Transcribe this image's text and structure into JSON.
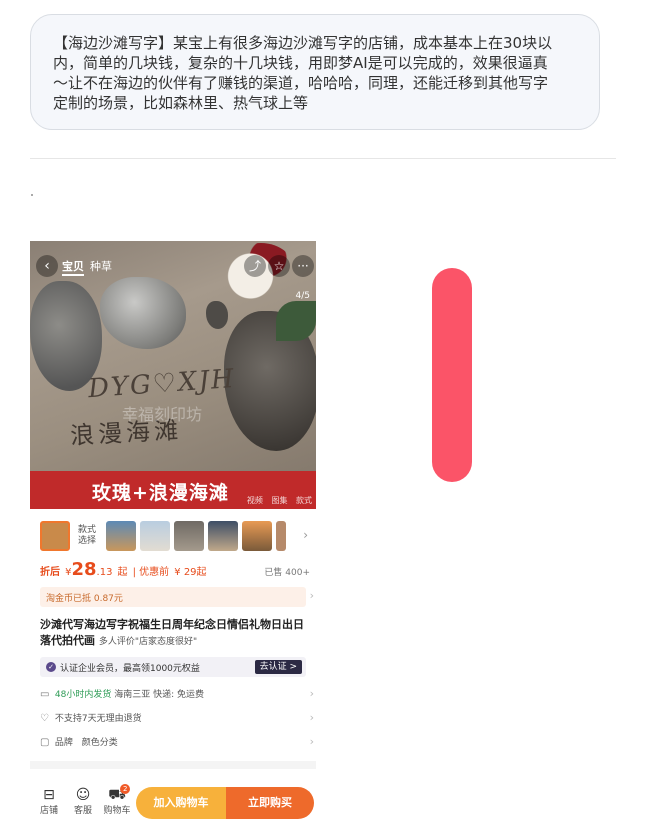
{
  "post": {
    "lines": [
      "【海边沙滩写字】某宝上有很多海边沙滩写字的店铺，成本基本上在30块以",
      "内，简单的几块钱，复杂的十几块钱，用即梦AI是可以完成的，效果很逼真",
      "～让不在海边的伙伴有了赚钱的渠道，哈哈哈，同理，还能迁移到其他写字",
      "定制的场景，比如森林里、热气球上等"
    ]
  },
  "product": {
    "topbar": {
      "tab1": "宝贝",
      "tab2": "种草",
      "counter": "4/5"
    },
    "hero": {
      "sand_text": "DYG♡XJH",
      "sand_text2": "浪漫海滩",
      "watermark": "幸福刻印坊"
    },
    "banner": {
      "text": "玫瑰+浪漫海滩",
      "tabs": [
        "视频",
        "图集",
        "款式"
      ]
    },
    "style_label_1": "款式",
    "style_label_2": "选择",
    "price": {
      "label": "折后",
      "currency": "¥",
      "main": "28",
      "decimal": ".13",
      "suffix": "起",
      "before_label": "| 优惠前",
      "before_value": "¥ 29起",
      "sold": "已售 400+"
    },
    "coin": "淘金币已抵 0.87元",
    "title": "沙滩代写海边写字祝福生日周年纪念日情侣礼物日出日落代拍代画",
    "review": "多人评价\"店家态度很好\"",
    "cert": {
      "text": "认证企业会员，最高领1000元权益",
      "button": "去认证 >"
    },
    "shipping": {
      "fast": "48小时内发货",
      "rest": "海南三亚  快递: 免运费"
    },
    "returns": "不支持7天无理由退货",
    "brand": {
      "label": "品牌",
      "value": "颜色分类"
    },
    "bottom": {
      "shop": "店铺",
      "service": "客服",
      "cart": "购物车",
      "cart_badge": "2",
      "add_to_cart": "加入购物车",
      "buy_now": "立即购买"
    }
  },
  "colors": {
    "highlight_bar": "#fb5468",
    "price": "#e74c1c",
    "banner": "#c02a2a",
    "cart_button": "#f7b13b",
    "buy_button": "#ee6a2b"
  }
}
